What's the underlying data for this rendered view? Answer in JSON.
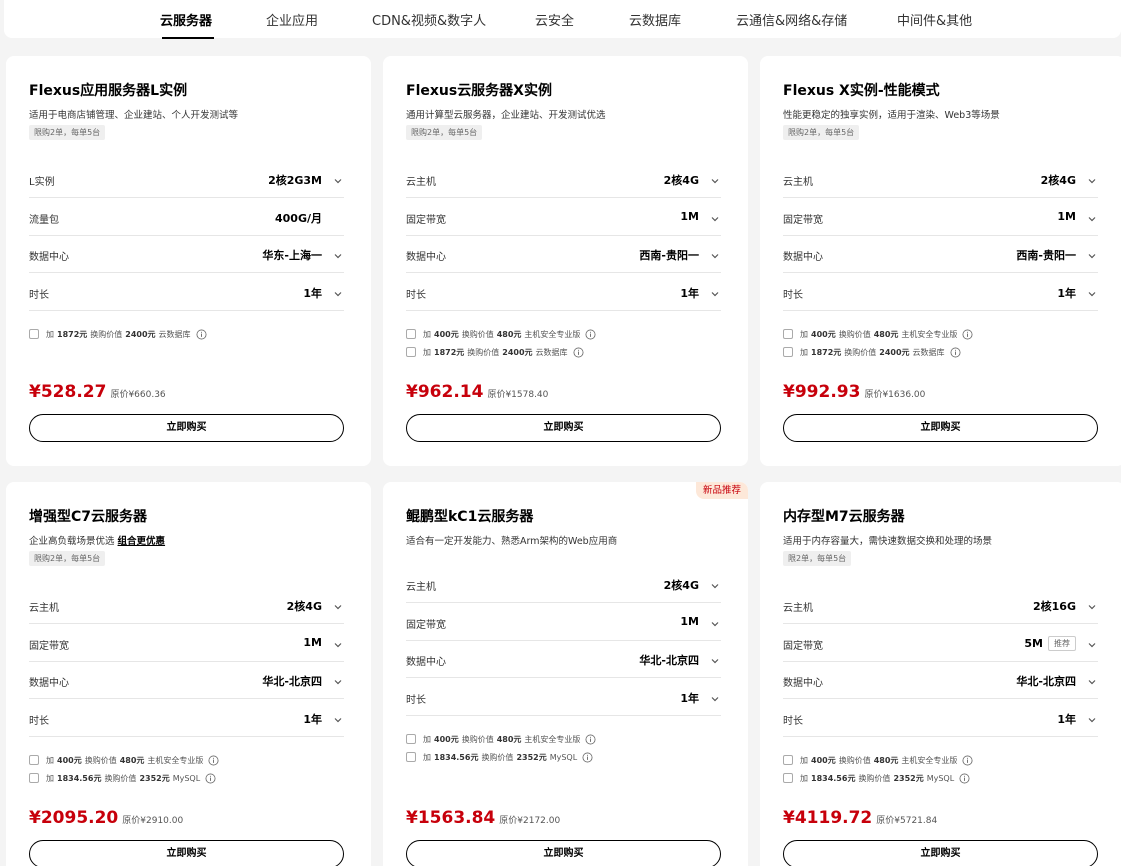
{
  "nav": {
    "tabs": [
      "云服务器",
      "企业应用",
      "CDN&视频&数字人",
      "云安全",
      "云数据库",
      "云通信&网络&存储",
      "中间件&其他"
    ]
  },
  "cards": [
    {
      "title": "Flexus应用服务器L实例",
      "desc": "适用于电商店铺管理、企业建站、个人开发测试等",
      "limit": "限购2单，每单5台",
      "specs": [
        {
          "label": "L实例",
          "value": "2核2G3M"
        },
        {
          "label": "流量包",
          "value": "400G/月"
        },
        {
          "label": "数据中心",
          "value": "华东-上海一"
        },
        {
          "label": "时长",
          "value": "1年"
        }
      ],
      "addons": [
        {
          "prefix": "加",
          "amount": "1872元",
          "text": "换购价值",
          "worth": "2400元",
          "product": "云数据库"
        }
      ],
      "price": "¥528.27",
      "original": "原价¥660.36",
      "buy": "立即购买"
    },
    {
      "title": "Flexus云服务器X实例",
      "desc": "通用计算型云服务器，企业建站、开发测试优选",
      "limit": "限购2单，每单5台",
      "specs": [
        {
          "label": "云主机",
          "value": "2核4G"
        },
        {
          "label": "固定带宽",
          "value": "1M"
        },
        {
          "label": "数据中心",
          "value": "西南-贵阳一"
        },
        {
          "label": "时长",
          "value": "1年"
        }
      ],
      "addons": [
        {
          "prefix": "加",
          "amount": "400元",
          "text": "换购价值",
          "worth": "480元",
          "product": "主机安全专业版"
        },
        {
          "prefix": "加",
          "amount": "1872元",
          "text": "换购价值",
          "worth": "2400元",
          "product": "云数据库"
        }
      ],
      "price": "¥962.14",
      "original": "原价¥1578.40",
      "buy": "立即购买"
    },
    {
      "title": "Flexus X实例-性能模式",
      "desc": "性能更稳定的独享实例，适用于渲染、Web3等场景",
      "limit": "限购2单，每单5台",
      "specs": [
        {
          "label": "云主机",
          "value": "2核4G"
        },
        {
          "label": "固定带宽",
          "value": "1M"
        },
        {
          "label": "数据中心",
          "value": "西南-贵阳一"
        },
        {
          "label": "时长",
          "value": "1年"
        }
      ],
      "addons": [
        {
          "prefix": "加",
          "amount": "400元",
          "text": "换购价值",
          "worth": "480元",
          "product": "主机安全专业版"
        },
        {
          "prefix": "加",
          "amount": "1872元",
          "text": "换购价值",
          "worth": "2400元",
          "product": "云数据库"
        }
      ],
      "price": "¥992.93",
      "original": "原价¥1636.00",
      "buy": "立即购买"
    },
    {
      "title": "增强型C7云服务器",
      "desc": "企业高负载场景优选",
      "desc_link": "组合更优惠",
      "limit": "限购2单，每单5台",
      "specs": [
        {
          "label": "云主机",
          "value": "2核4G"
        },
        {
          "label": "固定带宽",
          "value": "1M"
        },
        {
          "label": "数据中心",
          "value": "华北-北京四"
        },
        {
          "label": "时长",
          "value": "1年"
        }
      ],
      "addons": [
        {
          "prefix": "加",
          "amount": "400元",
          "text": "换购价值",
          "worth": "480元",
          "product": "主机安全专业版"
        },
        {
          "prefix": "加",
          "amount": "1834.56元",
          "text": "换购价值",
          "worth": "2352元",
          "product": "MySQL"
        }
      ],
      "price": "¥2095.20",
      "original": "原价¥2910.00",
      "buy": "立即购买"
    },
    {
      "badge": "新品推荐",
      "title": "鲲鹏型kC1云服务器",
      "desc": "适合有一定开发能力、熟悉Arm架构的Web应用商",
      "specs": [
        {
          "label": "云主机",
          "value": "2核4G"
        },
        {
          "label": "固定带宽",
          "value": "1M"
        },
        {
          "label": "数据中心",
          "value": "华北-北京四"
        },
        {
          "label": "时长",
          "value": "1年"
        }
      ],
      "addons": [
        {
          "prefix": "加",
          "amount": "400元",
          "text": "换购价值",
          "worth": "480元",
          "product": "主机安全专业版"
        },
        {
          "prefix": "加",
          "amount": "1834.56元",
          "text": "换购价值",
          "worth": "2352元",
          "product": "MySQL"
        }
      ],
      "price": "¥1563.84",
      "original": "原价¥2172.00",
      "buy": "立即购买"
    },
    {
      "title": "内存型M7云服务器",
      "desc": "适用于内存容量大，需快速数据交换和处理的场景",
      "limit": "限2单，每单5台",
      "specs": [
        {
          "label": "云主机",
          "value": "2核16G"
        },
        {
          "label": "固定带宽",
          "value": "5M",
          "tag": "推荐"
        },
        {
          "label": "数据中心",
          "value": "华北-北京四"
        },
        {
          "label": "时长",
          "value": "1年"
        }
      ],
      "addons": [
        {
          "prefix": "加",
          "amount": "400元",
          "text": "换购价值",
          "worth": "480元",
          "product": "主机安全专业版"
        },
        {
          "prefix": "加",
          "amount": "1834.56元",
          "text": "换购价值",
          "worth": "2352元",
          "product": "MySQL"
        }
      ],
      "price": "¥4119.72",
      "original": "原价¥5721.84",
      "buy": "立即购买"
    }
  ],
  "colors": {
    "accent": "#c7000b",
    "background": "#f4f4f4",
    "card": "#ffffff"
  }
}
